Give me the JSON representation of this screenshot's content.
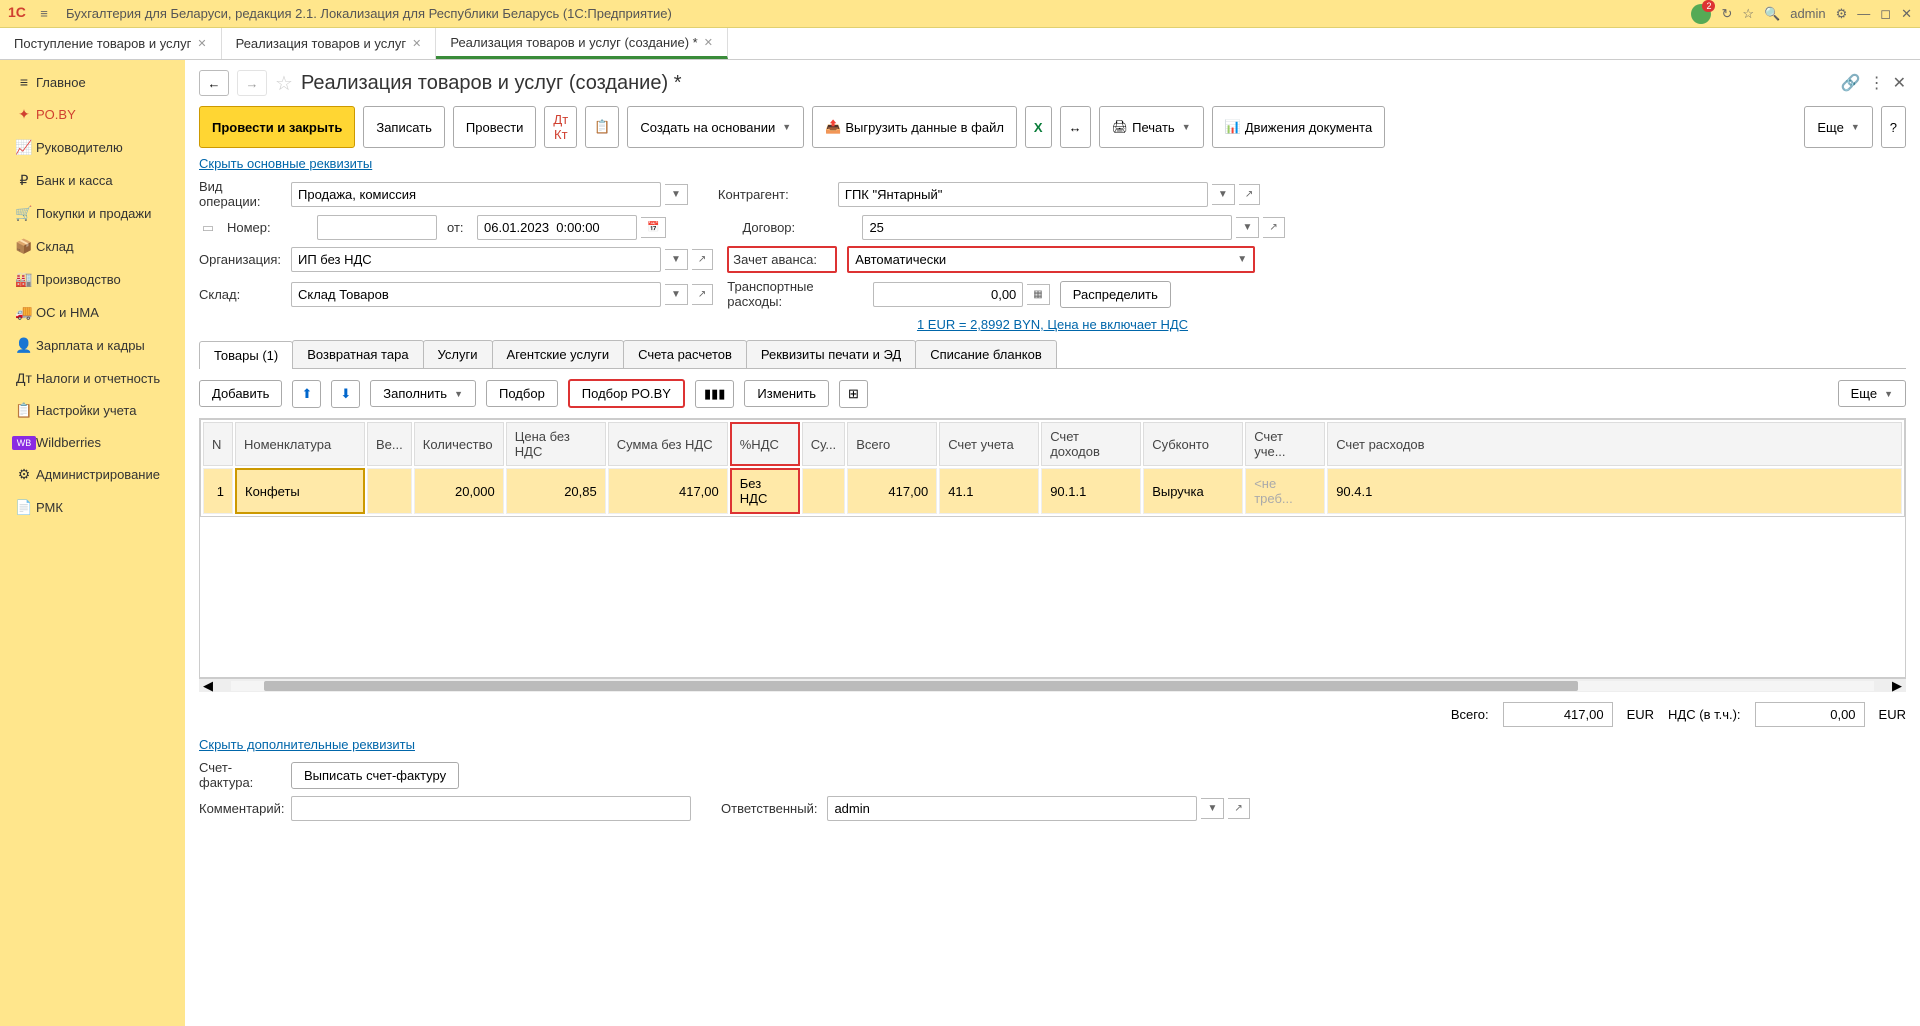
{
  "app": {
    "title": "Бухгалтерия для Беларуси, редакция 2.1. Локализация для Республики Беларусь   (1С:Предприятие)",
    "user": "admin",
    "notif_count": "2"
  },
  "tabs": [
    {
      "label": "Поступление товаров и услуг"
    },
    {
      "label": "Реализация товаров и услуг"
    },
    {
      "label": "Реализация товаров и услуг (создание) *",
      "active": true
    }
  ],
  "sidebar": [
    {
      "icon": "≡",
      "label": "Главное"
    },
    {
      "icon": "✦",
      "label": "PO.BY"
    },
    {
      "icon": "📈",
      "label": "Руководителю"
    },
    {
      "icon": "₽",
      "label": "Банк и касса"
    },
    {
      "icon": "🛒",
      "label": "Покупки и продажи"
    },
    {
      "icon": "📦",
      "label": "Склад"
    },
    {
      "icon": "🏭",
      "label": "Производство"
    },
    {
      "icon": "🚚",
      "label": "ОС и НМА"
    },
    {
      "icon": "👤",
      "label": "Зарплата и кадры"
    },
    {
      "icon": "Дт",
      "label": "Налоги и отчетность"
    },
    {
      "icon": "📋",
      "label": "Настройки учета"
    },
    {
      "icon": "WB",
      "label": "Wildberries"
    },
    {
      "icon": "⚙",
      "label": "Администрирование"
    },
    {
      "icon": "📄",
      "label": "РМК"
    }
  ],
  "page": {
    "title": "Реализация товаров и услуг (создание) *",
    "hide_link": "Скрыть основные реквизиты",
    "hide_link2": "Скрыть дополнительные реквизиты",
    "rate_link": "1 EUR = 2,8992 BYN, Цена не включает НДС"
  },
  "toolbar": {
    "post_close": "Провести и закрыть",
    "save": "Записать",
    "post": "Провести",
    "create_based": "Создать на основании",
    "export": "Выгрузить данные в файл",
    "print": "Печать",
    "movements": "Движения документа",
    "more": "Еще"
  },
  "form": {
    "op_type_lbl": "Вид операции:",
    "op_type": "Продажа, комиссия",
    "number_lbl": "Номер:",
    "number": "",
    "from_lbl": "от:",
    "date": "06.01.2023  0:00:00",
    "org_lbl": "Организация:",
    "org": "ИП без НДС",
    "wh_lbl": "Склад:",
    "wh": "Склад Товаров",
    "partner_lbl": "Контрагент:",
    "partner": "ГПК \"Янтарный\"",
    "contract_lbl": "Договор:",
    "contract": "25",
    "advance_lbl": "Зачет аванса:",
    "advance": "Автоматически",
    "transport_lbl": "Транспортные расходы:",
    "transport": "0,00",
    "distribute": "Распределить"
  },
  "subtabs": [
    {
      "label": "Товары (1)",
      "active": true
    },
    {
      "label": "Возвратная тара"
    },
    {
      "label": "Услуги"
    },
    {
      "label": "Агентские услуги"
    },
    {
      "label": "Счета расчетов"
    },
    {
      "label": "Реквизиты печати и ЭД"
    },
    {
      "label": "Списание бланков"
    }
  ],
  "subtoolbar": {
    "add": "Добавить",
    "fill": "Заполнить",
    "select": "Подбор",
    "select_poby": "Подбор PO.BY",
    "change": "Изменить",
    "more": "Еще"
  },
  "table": {
    "headers": [
      "N",
      "Номенклатура",
      "Ве...",
      "Количество",
      "Цена без НДС",
      "Сумма без НДС",
      "%НДС",
      "Су...",
      "Всего",
      "Счет учета",
      "Счет доходов",
      "Субконто",
      "Счет уче...",
      "Счет расходов"
    ],
    "row": {
      "n": "1",
      "name": "Конфеты",
      "weight": "",
      "qty": "20,000",
      "price": "20,85",
      "sum": "417,00",
      "vat": "Без НДС",
      "vsum": "",
      "total": "417,00",
      "acc": "41.1",
      "inc": "90.1.1",
      "sub": "Выручка",
      "acc2": "<не треб...",
      "exp": "90.4.1"
    }
  },
  "totals": {
    "total_lbl": "Всего:",
    "total": "417,00",
    "cur": "EUR",
    "vat_lbl": "НДС (в т.ч.):",
    "vat": "0,00"
  },
  "footer": {
    "invoice_lbl": "Счет-фактура:",
    "invoice_btn": "Выписать счет-фактуру",
    "comment_lbl": "Комментарий:",
    "comment": "",
    "resp_lbl": "Ответственный:",
    "resp": "admin"
  }
}
